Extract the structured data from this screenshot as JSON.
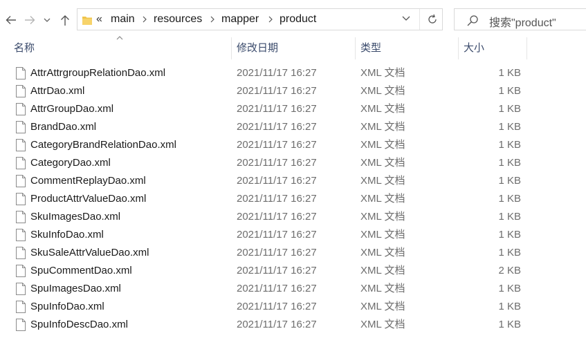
{
  "address_bar": {
    "overflow": "«",
    "breadcrumbs": [
      "main",
      "resources",
      "mapper",
      "product"
    ]
  },
  "search": {
    "placeholder": "搜索\"product\""
  },
  "columns": {
    "name": "名称",
    "modified": "修改日期",
    "type": "类型",
    "size": "大小"
  },
  "files": [
    {
      "name": "AttrAttrgroupRelationDao.xml",
      "modified": "2021/11/17 16:27",
      "type": "XML 文档",
      "size": "1 KB"
    },
    {
      "name": "AttrDao.xml",
      "modified": "2021/11/17 16:27",
      "type": "XML 文档",
      "size": "1 KB"
    },
    {
      "name": "AttrGroupDao.xml",
      "modified": "2021/11/17 16:27",
      "type": "XML 文档",
      "size": "1 KB"
    },
    {
      "name": "BrandDao.xml",
      "modified": "2021/11/17 16:27",
      "type": "XML 文档",
      "size": "1 KB"
    },
    {
      "name": "CategoryBrandRelationDao.xml",
      "modified": "2021/11/17 16:27",
      "type": "XML 文档",
      "size": "1 KB"
    },
    {
      "name": "CategoryDao.xml",
      "modified": "2021/11/17 16:27",
      "type": "XML 文档",
      "size": "1 KB"
    },
    {
      "name": "CommentReplayDao.xml",
      "modified": "2021/11/17 16:27",
      "type": "XML 文档",
      "size": "1 KB"
    },
    {
      "name": "ProductAttrValueDao.xml",
      "modified": "2021/11/17 16:27",
      "type": "XML 文档",
      "size": "1 KB"
    },
    {
      "name": "SkuImagesDao.xml",
      "modified": "2021/11/17 16:27",
      "type": "XML 文档",
      "size": "1 KB"
    },
    {
      "name": "SkuInfoDao.xml",
      "modified": "2021/11/17 16:27",
      "type": "XML 文档",
      "size": "1 KB"
    },
    {
      "name": "SkuSaleAttrValueDao.xml",
      "modified": "2021/11/17 16:27",
      "type": "XML 文档",
      "size": "1 KB"
    },
    {
      "name": "SpuCommentDao.xml",
      "modified": "2021/11/17 16:27",
      "type": "XML 文档",
      "size": "2 KB"
    },
    {
      "name": "SpuImagesDao.xml",
      "modified": "2021/11/17 16:27",
      "type": "XML 文档",
      "size": "1 KB"
    },
    {
      "name": "SpuInfoDao.xml",
      "modified": "2021/11/17 16:27",
      "type": "XML 文档",
      "size": "1 KB"
    },
    {
      "name": "SpuInfoDescDao.xml",
      "modified": "2021/11/17 16:27",
      "type": "XML 文档",
      "size": "1 KB"
    }
  ],
  "icons": {
    "back": "arrow-left-icon",
    "forward": "arrow-right-icon",
    "recent": "chevron-down-icon",
    "up": "arrow-up-icon",
    "folder": "folder-icon",
    "refresh": "refresh-icon",
    "search": "search-icon",
    "file": "file-icon",
    "sort": "sort-ascending-icon"
  },
  "colors": {
    "folder": "#f0c44a",
    "header_text": "#3a4a6b",
    "secondary_text": "#6d6d6d"
  }
}
